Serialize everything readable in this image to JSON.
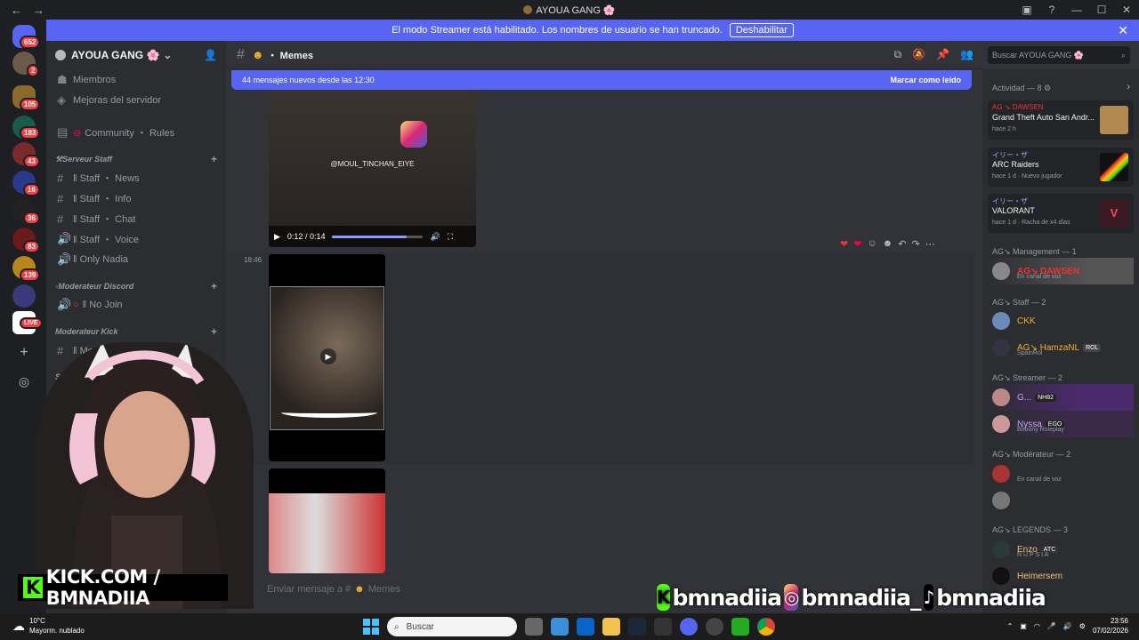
{
  "window": {
    "title": "AYOUA GANG 🌸"
  },
  "banner": {
    "text": "El modo Streamer está habilitado. Los nombres de usuario se han truncado.",
    "button": "Deshabilitar"
  },
  "server_badges": [
    "652",
    "2",
    "105",
    "183",
    "43",
    "16",
    "36",
    "83",
    "139",
    "LIVE"
  ],
  "sidebar": {
    "server_name": "AYOUA GANG 🌸",
    "top_items": [
      "Miembros",
      "Mejoras del servidor"
    ],
    "community_rules": "Community ・ Rules",
    "categories": [
      {
        "name": "Serveur Staff",
        "channels": [
          "ǁ Staff ・ News",
          "ǁ Staff ・ Info",
          "ǁ Staff ・ Chat",
          "ǁ Staff ・ Voice",
          "ǁ Only Nadia"
        ]
      },
      {
        "name": "Moderateur Discord",
        "channels": [
          "ǁ No Join"
        ]
      },
      {
        "name": "Moderateur Kick",
        "channels": [
          "ǁ Moderateur ・ Chat"
        ]
      }
    ],
    "partial_category": "Su"
  },
  "chat": {
    "channel": "・ Memes",
    "new_messages": "44 mensajes nuevos desde las 12:30",
    "mark_read": "Marcar como leído",
    "video1": {
      "handle": "@MOUL_TINCHAN_EIYE",
      "time": "0:12 / 0:14",
      "progress": 0.82
    },
    "timestamp": "18:46",
    "input_placeholder": "Enviar mensaje a #",
    "input_channel": "Memes"
  },
  "search": {
    "placeholder": "Buscar AYOUA GANG 🌸"
  },
  "right_panel": {
    "activity_header": "Actividad — 8",
    "activities": [
      {
        "user": "AG ↘ DAWSEN",
        "game": "Grand Theft Auto San Andr...",
        "sub": "hace 2 h"
      },
      {
        "user": "イリー・ザ",
        "game": "ARC Raiders",
        "sub": "hace 1 d",
        "extra": "Nuevo jugador"
      },
      {
        "user": "イリー・ザ",
        "game": "VALORANT",
        "sub": "hace 1 d",
        "extra": "Racha de x4 días"
      }
    ],
    "groups": [
      {
        "name": "AG↘ Management — 1",
        "members": [
          {
            "name": "AG↘ DAWSEN",
            "status": "En canal de voz"
          }
        ]
      },
      {
        "name": "AG↘ Staff — 2",
        "members": [
          {
            "name": "CKK",
            "status": ""
          },
          {
            "name": "AG↘ HamzaNL",
            "tag": "ROL",
            "status": "SpainRol"
          }
        ]
      },
      {
        "name": "AG↘ Streamer — 2",
        "members": [
          {
            "name": "G...",
            "tag": "NH82",
            "status": ""
          },
          {
            "name": "Nyssa",
            "tag": "EGO",
            "status": "Bobony Roleplay"
          }
        ]
      },
      {
        "name": "AG↘ Modérateur — 2",
        "members": [
          {
            "name": "",
            "status": "En canal de voz"
          },
          {
            "name": "",
            "status": ""
          }
        ]
      },
      {
        "name": "AG↘ LEGENDS — 3",
        "members": [
          {
            "name": "Enzo",
            "tag": "ATC",
            "status": "N U P S I A"
          },
          {
            "name": "Heimersem",
            "status": ""
          }
        ]
      }
    ]
  },
  "overlay": {
    "kick": "KICK.COM / BMNADIIA",
    "kick_logo": "K",
    "social_handles": [
      "bmnadiia",
      "bmnadiia_",
      "bmnadiia"
    ]
  },
  "taskbar": {
    "temp": "10°C",
    "weather": "Mayorm. nublado",
    "search": "Buscar",
    "time": "23:56",
    "date": "07/02/2026"
  }
}
